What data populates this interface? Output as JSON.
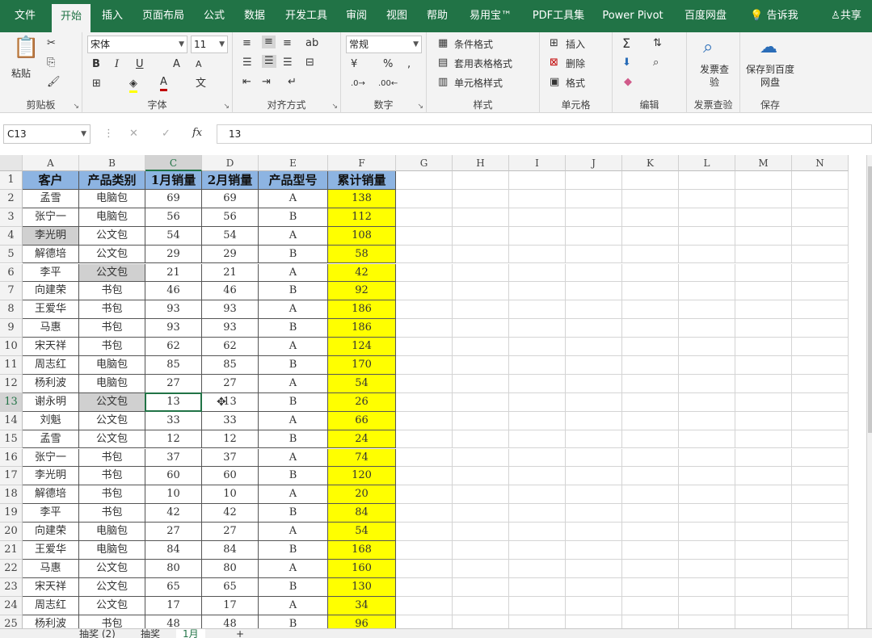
{
  "menu": {
    "tabs": [
      "文件",
      "开始",
      "插入",
      "页面布局",
      "公式",
      "数据",
      "开发工具",
      "审阅",
      "视图",
      "帮助",
      "易用宝™",
      "PDF工具集",
      "Power Pivot",
      "百度网盘"
    ],
    "tell_me": "告诉我",
    "share": "共享"
  },
  "ribbon": {
    "paste": "粘贴",
    "clipboard": "剪贴板",
    "font_name": "宋体",
    "font_size": "11",
    "bold": "B",
    "italic": "I",
    "underline": "U",
    "grow": "A",
    "shrink": "A",
    "font_color": "A",
    "wen": "文",
    "font": "字体",
    "alignment": "对齐方式",
    "num_format": "常规",
    "number": "数字",
    "percent": "%",
    "comma": ",",
    "cond_format": "条件格式",
    "table_format": "套用表格格式",
    "cell_style": "单元格样式",
    "styles": "样式",
    "insert": "插入",
    "delete": "删除",
    "format": "格式",
    "cells": "单元格",
    "editing": "编辑",
    "invoice_check": "发票查验",
    "invoice_btn": "发票查验",
    "save_baidu": "保存到百度网盘",
    "save": "保存",
    "colors": {
      "ribbon_green": "#217346",
      "header_blue": "#8db4e2",
      "highlight_yellow": "#ffff00",
      "font_red": "#c00000"
    }
  },
  "formula": {
    "namebox": "C13",
    "cancel": "✕",
    "enter": "✓",
    "fx": "fx",
    "value": "13"
  },
  "sheet": {
    "columns": [
      "A",
      "B",
      "C",
      "D",
      "E",
      "F",
      "G",
      "H",
      "I",
      "J",
      "K",
      "L",
      "M",
      "N"
    ],
    "header": [
      "客户",
      "产品类别",
      "1月销量",
      "2月销量",
      "产品型号",
      "累计销量"
    ],
    "rows": [
      [
        "孟雪",
        "电脑包",
        "69",
        "69",
        "A",
        "138"
      ],
      [
        "张宁一",
        "电脑包",
        "56",
        "56",
        "B",
        "112"
      ],
      [
        "李光明",
        "公文包",
        "54",
        "54",
        "A",
        "108"
      ],
      [
        "解德培",
        "公文包",
        "29",
        "29",
        "B",
        "58"
      ],
      [
        "李平",
        "公文包",
        "21",
        "21",
        "A",
        "42"
      ],
      [
        "向建荣",
        "书包",
        "46",
        "46",
        "B",
        "92"
      ],
      [
        "王爱华",
        "书包",
        "93",
        "93",
        "A",
        "186"
      ],
      [
        "马惠",
        "书包",
        "93",
        "93",
        "B",
        "186"
      ],
      [
        "宋天祥",
        "书包",
        "62",
        "62",
        "A",
        "124"
      ],
      [
        "周志红",
        "电脑包",
        "85",
        "85",
        "B",
        "170"
      ],
      [
        "杨利波",
        "电脑包",
        "27",
        "27",
        "A",
        "54"
      ],
      [
        "谢永明",
        "公文包",
        "13",
        "13",
        "B",
        "26"
      ],
      [
        "刘魁",
        "公文包",
        "33",
        "33",
        "A",
        "66"
      ],
      [
        "孟雪",
        "公文包",
        "12",
        "12",
        "B",
        "24"
      ],
      [
        "张宁一",
        "书包",
        "37",
        "37",
        "A",
        "74"
      ],
      [
        "李光明",
        "书包",
        "60",
        "60",
        "B",
        "120"
      ],
      [
        "解德培",
        "书包",
        "10",
        "10",
        "A",
        "20"
      ],
      [
        "李平",
        "书包",
        "42",
        "42",
        "B",
        "84"
      ],
      [
        "向建荣",
        "电脑包",
        "27",
        "27",
        "A",
        "54"
      ],
      [
        "王爱华",
        "电脑包",
        "84",
        "84",
        "B",
        "168"
      ],
      [
        "马惠",
        "公文包",
        "80",
        "80",
        "A",
        "160"
      ],
      [
        "宋天祥",
        "公文包",
        "65",
        "65",
        "B",
        "130"
      ],
      [
        "周志红",
        "公文包",
        "17",
        "17",
        "A",
        "34"
      ],
      [
        "杨利波",
        "书包",
        "48",
        "48",
        "B",
        "96"
      ]
    ],
    "selected_col": "C",
    "selected_row": "13"
  },
  "sheet_tabs": [
    "抽奖 (2)",
    "抽奖",
    "1月"
  ],
  "add_sheet": "+"
}
